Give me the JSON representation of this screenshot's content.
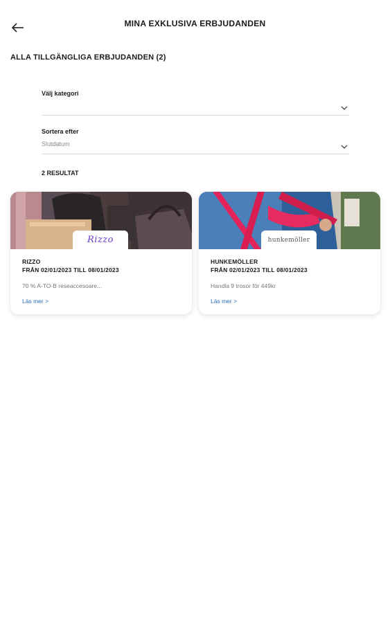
{
  "header": {
    "title": "MINA EXKLUSIVA ERBJUDANDEN",
    "back_icon": "arrow-left-icon"
  },
  "section": {
    "title": "ALLA TILLGÄNGLIGA ERBJUDANDEN (2)"
  },
  "filters": {
    "category": {
      "label": "Välj kategori",
      "value": ""
    },
    "sort": {
      "label": "Sortera efter",
      "value": "Slutdatum"
    }
  },
  "results": {
    "count_label": "2 RESULTAT"
  },
  "offers": [
    {
      "brand": "RIZZO",
      "logo_text": "Rizzo",
      "dates": "FRÅN 02/01/2023 TILL 08/01/2023",
      "description": "70 % A-TO-B reseaccesoare...",
      "link": "Läs mer >"
    },
    {
      "brand": "HUNKEMÖLLER",
      "logo_text": "hunkemöller",
      "dates": "FRÅN 02/01/2023 TILL 08/01/2023",
      "description": "Handla 9 trosor för 449kr",
      "link": "Läs mer >"
    }
  ],
  "colors": {
    "link": "#2a6fb6",
    "rizzo_logo": "#6b3cc9",
    "divider": "#d9d9d9"
  }
}
